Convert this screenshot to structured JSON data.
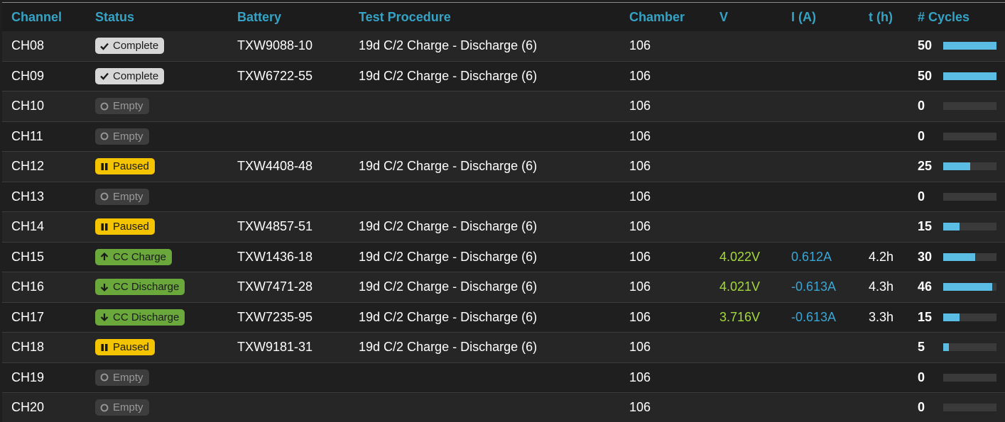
{
  "colors": {
    "header": "#35a3c5",
    "voltage": "#a4d93a",
    "current": "#3aa6d6",
    "complete": "#d7d7d7",
    "empty": "#3d3d3d",
    "paused": "#f5c400",
    "charge": "#6aa83c",
    "cycle_bar": "#5bbde3"
  },
  "columns": {
    "channel": "Channel",
    "status": "Status",
    "battery": "Battery",
    "procedure": "Test Procedure",
    "chamber": "Chamber",
    "v": "V",
    "i": "I (A)",
    "t": "t (h)",
    "cycles": "# Cycles"
  },
  "max_cycles": 50,
  "rows": [
    {
      "channel": "CH08",
      "status": "Complete",
      "status_type": "complete",
      "icon": "check-icon",
      "battery": "TXW9088-10",
      "procedure": "19d C/2 Charge - Discharge (6)",
      "chamber": "106",
      "v": "",
      "i": "",
      "t": "",
      "cycles": 50
    },
    {
      "channel": "CH09",
      "status": "Complete",
      "status_type": "complete",
      "icon": "check-icon",
      "battery": "TXW6722-55",
      "procedure": "19d C/2 Charge - Discharge (6)",
      "chamber": "106",
      "v": "",
      "i": "",
      "t": "",
      "cycles": 50
    },
    {
      "channel": "CH10",
      "status": "Empty",
      "status_type": "empty",
      "icon": "circle-icon",
      "battery": "",
      "procedure": "",
      "chamber": "106",
      "v": "",
      "i": "",
      "t": "",
      "cycles": 0
    },
    {
      "channel": "CH11",
      "status": "Empty",
      "status_type": "empty",
      "icon": "circle-icon",
      "battery": "",
      "procedure": "",
      "chamber": "106",
      "v": "",
      "i": "",
      "t": "",
      "cycles": 0
    },
    {
      "channel": "CH12",
      "status": "Paused",
      "status_type": "paused",
      "icon": "pause-icon",
      "battery": "TXW4408-48",
      "procedure": "19d C/2 Charge - Discharge (6)",
      "chamber": "106",
      "v": "",
      "i": "",
      "t": "",
      "cycles": 25
    },
    {
      "channel": "CH13",
      "status": "Empty",
      "status_type": "empty",
      "icon": "circle-icon",
      "battery": "",
      "procedure": "",
      "chamber": "106",
      "v": "",
      "i": "",
      "t": "",
      "cycles": 0
    },
    {
      "channel": "CH14",
      "status": "Paused",
      "status_type": "paused",
      "icon": "pause-icon",
      "battery": "TXW4857-51",
      "procedure": "19d C/2 Charge - Discharge (6)",
      "chamber": "106",
      "v": "",
      "i": "",
      "t": "",
      "cycles": 15
    },
    {
      "channel": "CH15",
      "status": "CC Charge",
      "status_type": "charge",
      "icon": "arrow-up-icon",
      "battery": "TXW1436-18",
      "procedure": "19d C/2 Charge - Discharge (6)",
      "chamber": "106",
      "v": "4.022V",
      "i": "0.612A",
      "t": "4.2h",
      "cycles": 30
    },
    {
      "channel": "CH16",
      "status": "CC Discharge",
      "status_type": "discharge",
      "icon": "arrow-down-icon",
      "battery": "TXW7471-28",
      "procedure": "19d C/2 Charge - Discharge (6)",
      "chamber": "106",
      "v": "4.021V",
      "i": "-0.613A",
      "t": "4.3h",
      "cycles": 46
    },
    {
      "channel": "CH17",
      "status": "CC Discharge",
      "status_type": "discharge",
      "icon": "arrow-down-icon",
      "battery": "TXW7235-95",
      "procedure": "19d C/2 Charge - Discharge (6)",
      "chamber": "106",
      "v": "3.716V",
      "i": "-0.613A",
      "t": "3.3h",
      "cycles": 15
    },
    {
      "channel": "CH18",
      "status": "Paused",
      "status_type": "paused",
      "icon": "pause-icon",
      "battery": "TXW9181-31",
      "procedure": "19d C/2 Charge - Discharge (6)",
      "chamber": "106",
      "v": "",
      "i": "",
      "t": "",
      "cycles": 5
    },
    {
      "channel": "CH19",
      "status": "Empty",
      "status_type": "empty",
      "icon": "circle-icon",
      "battery": "",
      "procedure": "",
      "chamber": "106",
      "v": "",
      "i": "",
      "t": "",
      "cycles": 0
    },
    {
      "channel": "CH20",
      "status": "Empty",
      "status_type": "empty",
      "icon": "circle-icon",
      "battery": "",
      "procedure": "",
      "chamber": "106",
      "v": "",
      "i": "",
      "t": "",
      "cycles": 0
    }
  ]
}
